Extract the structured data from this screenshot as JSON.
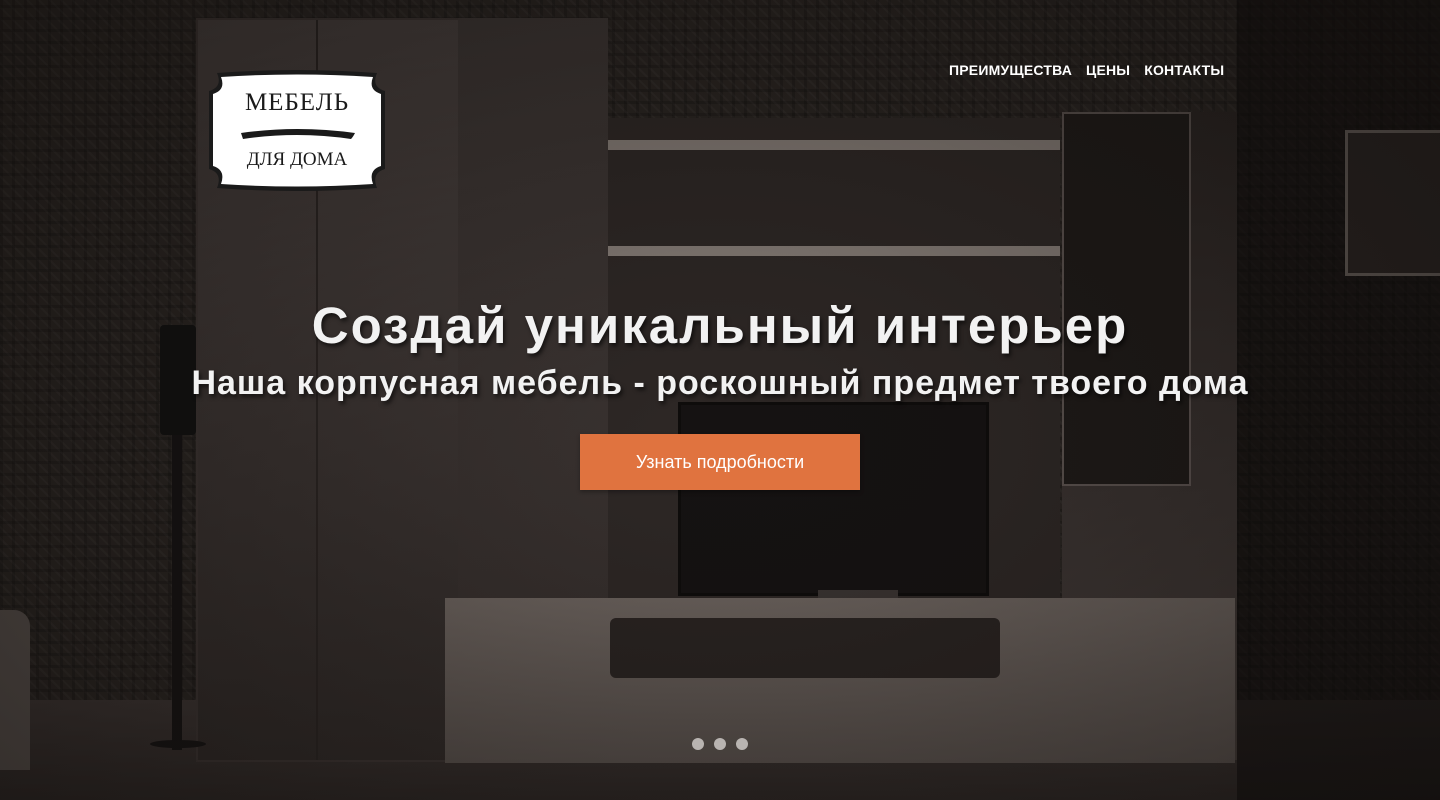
{
  "logo": {
    "line1": "МЕБЕЛЬ",
    "line2": "ДЛЯ ДОМА"
  },
  "nav": {
    "items": [
      {
        "label": "ПРЕИМУЩЕСТВА"
      },
      {
        "label": "ЦЕНЫ"
      },
      {
        "label": "КОНТАКТЫ"
      }
    ]
  },
  "hero": {
    "title": "Создай уникальный интерьер",
    "subtitle": "Наша корпусная мебель - роскошный предмет твоего дома",
    "cta_label": "Узнать подробности"
  },
  "slider": {
    "dot_count": 3
  },
  "colors": {
    "accent": "#e0733f",
    "text": "#f2f2f2",
    "dot": "#b9b4b1"
  }
}
